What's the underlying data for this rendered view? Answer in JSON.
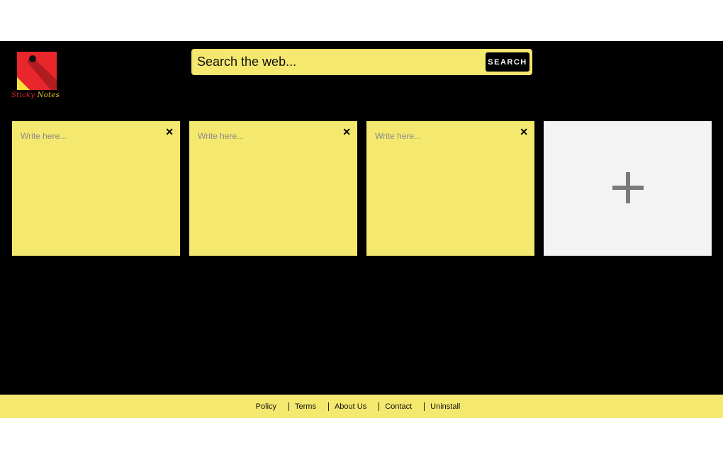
{
  "logo": {
    "word1": "Sticky",
    "word2": "Notes",
    "red": "#e8262b",
    "yellow": "#f6e23e"
  },
  "search": {
    "placeholder": "Search the web...",
    "button_label": "SEARCH"
  },
  "notes": [
    {
      "placeholder": "Write here...",
      "close_label": "✕"
    },
    {
      "placeholder": "Write here...",
      "close_label": "✕"
    },
    {
      "placeholder": "Write here...",
      "close_label": "✕"
    }
  ],
  "add_note": {
    "icon": "plus-icon"
  },
  "footer": {
    "links": [
      "Policy",
      "Terms",
      "About Us",
      "Contact",
      "Uninstall"
    ]
  },
  "colors": {
    "background": "#000000",
    "note_yellow": "#f5e86e",
    "add_card": "#f3f3f3"
  }
}
